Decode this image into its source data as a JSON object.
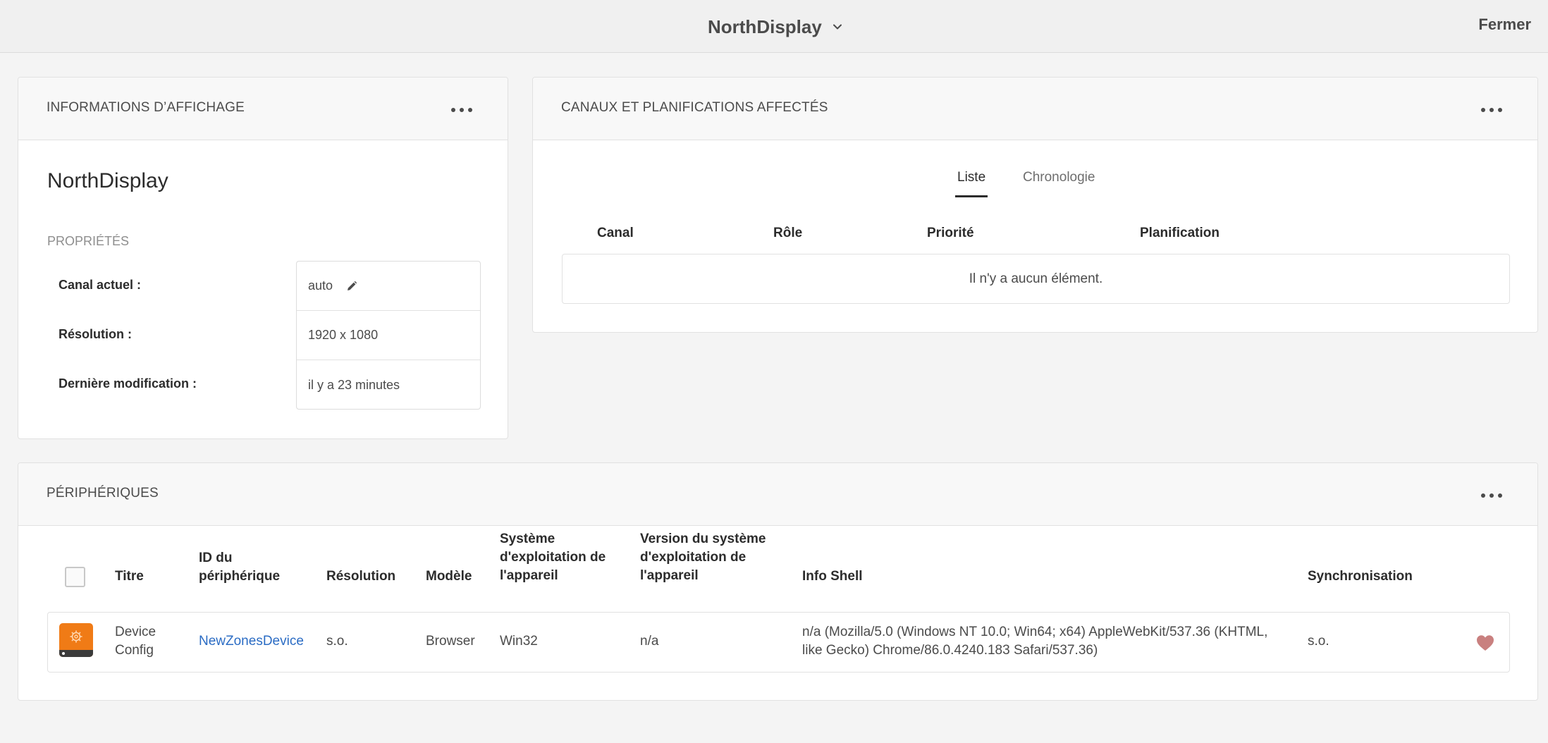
{
  "topbar": {
    "title": "NorthDisplay",
    "close_label": "Fermer"
  },
  "display_info": {
    "header": "INFORMATIONS D’AFFICHAGE",
    "name": "NorthDisplay",
    "properties_label": "PROPRIÉTÉS",
    "properties": [
      {
        "key": "Canal actuel :",
        "value": "auto"
      },
      {
        "key": "Résolution :",
        "value": "1920 x 1080"
      },
      {
        "key": "Dernière modification :",
        "value": "il y a 23 minutes"
      }
    ]
  },
  "channels": {
    "header": "CANAUX ET PLANIFICATIONS AFFECTÉS",
    "tabs": [
      {
        "label": "Liste",
        "active": true
      },
      {
        "label": "Chronologie",
        "active": false
      }
    ],
    "columns": [
      "Canal",
      "Rôle",
      "Priorité",
      "Planification"
    ],
    "empty_message": "Il n'y a aucun élément."
  },
  "devices": {
    "header": "PÉRIPHÉRIQUES",
    "columns": {
      "title": "Titre",
      "device_id_l1": "ID du",
      "device_id_l2": "périphérique",
      "resolution": "Résolution",
      "model": "Modèle",
      "os_l1": "Système",
      "os_l2": "d'exploitation de",
      "os_l3": "l'appareil",
      "osver_l1": "Version du système",
      "osver_l2": "d'exploitation de",
      "osver_l3": "l'appareil",
      "shell": "Info Shell",
      "sync": "Synchronisation"
    },
    "rows": [
      {
        "title_l1": "Device",
        "title_l2": "Config",
        "device_id": "NewZonesDevice",
        "resolution": "s.o.",
        "model": "Browser",
        "os": "Win32",
        "os_version": "n/a",
        "shell_l1": "n/a (Mozilla/5.0 (Windows NT 10.0; Win64; x64) AppleWebKit/537.36 (KHTML,",
        "shell_l2": "like Gecko) Chrome/86.0.4240.183 Safari/537.36)",
        "sync": "s.o.",
        "icon": "gear-icon",
        "status_icon": "heart-icon"
      }
    ]
  },
  "colors": {
    "accent_link": "#2b6cc4",
    "device_thumb": "#f07b16",
    "heart": "#c9807f"
  }
}
